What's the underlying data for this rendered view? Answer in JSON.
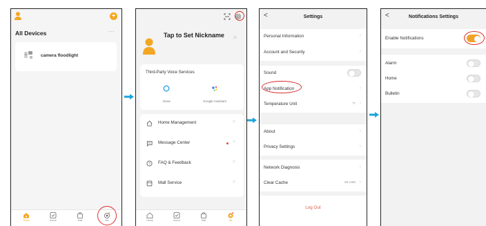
{
  "screen_home": {
    "title": "All Devices",
    "more": "···",
    "plus": "+",
    "device_name": "camera floodlight",
    "tabs": [
      {
        "label": "Home",
        "icon": "home-icon"
      },
      {
        "label": "Scene",
        "icon": "scene-icon"
      },
      {
        "label": "Mall",
        "icon": "mall-icon"
      },
      {
        "label": "Me",
        "icon": "me-icon"
      }
    ]
  },
  "screen_me": {
    "nickname": "Tap to Set Nickname",
    "voice_title": "Third-Party Voice Services",
    "voice_items": [
      "Alexa",
      "Google Assistant"
    ],
    "menu": [
      "Home Management",
      "Message Center",
      "FAQ & Feedback",
      "Mall Service"
    ],
    "chevron": ">",
    "tabs": [
      "Home",
      "Scene",
      "Mall",
      "Me"
    ]
  },
  "screen_settings": {
    "back": "<",
    "title": "Settings",
    "rows": {
      "personal": "Personal Information",
      "account": "Account and Security",
      "sound": "Sound",
      "app_notification": "App Notification",
      "temperature": "Temperature Unit",
      "temperature_value": "°F",
      "about": "About",
      "privacy": "Privacy Settings",
      "network": "Network Diagnosis",
      "cache": "Clear Cache",
      "cache_value": "65.18M"
    },
    "logout": "Log Out"
  },
  "screen_notifications": {
    "back": "<",
    "title": "Notifications Settings",
    "rows": [
      {
        "label": "Enable Notifications",
        "on": true
      },
      {
        "label": "Alarm",
        "on": false
      },
      {
        "label": "Home",
        "on": false
      },
      {
        "label": "Bulletin",
        "on": false
      }
    ]
  },
  "colors": {
    "accent": "#f4a623",
    "highlight_circle": "#d9302c",
    "arrow": "#1aa3dc",
    "logout": "#e05a4a"
  }
}
